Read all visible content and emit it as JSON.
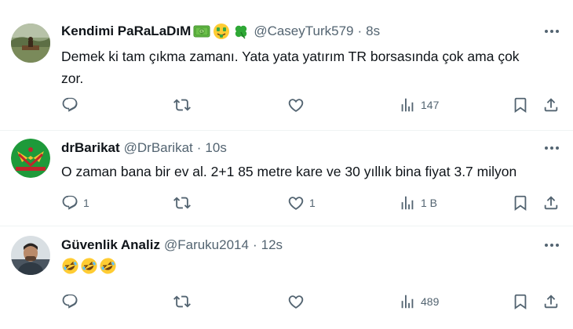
{
  "tweets": [
    {
      "display_name": "Kendimi PaRaLaDıM",
      "badge_icons": [
        "dollar-banknote-icon",
        "money-mouth-face-icon",
        "four-leaf-clover-icon"
      ],
      "handle": "@CaseyTurk579",
      "dot": "·",
      "time": "8s",
      "text_line1": "Demek ki tam çıkma zamanı. Yata yata yatırım TR borsasında çok ama çok",
      "text_line2": "zor.",
      "counts": {
        "reply": "",
        "retweet": "",
        "like": "",
        "views": "147"
      }
    },
    {
      "display_name": "drBarikat",
      "handle": "@DrBarikat",
      "dot": "·",
      "time": "10s",
      "text_line1": "O zaman bana bir ev al. 2+1 85 metre kare ve 30 yıllık bina fiyat 3.7 milyon",
      "counts": {
        "reply": "1",
        "retweet": "",
        "like": "1",
        "views": "1 B"
      }
    },
    {
      "display_name": "Güvenlik Analiz",
      "handle": "@Faruku2014",
      "dot": "·",
      "time": "12s",
      "text_emojis": [
        "rolling-on-floor-laughing-icon",
        "rolling-on-floor-laughing-icon",
        "rolling-on-floor-laughing-icon"
      ],
      "counts": {
        "reply": "",
        "retweet": "",
        "like": "",
        "views": "489"
      }
    }
  ],
  "colors": {
    "text": "#0f1419",
    "secondary": "#536471",
    "divider": "#eff3f4"
  }
}
